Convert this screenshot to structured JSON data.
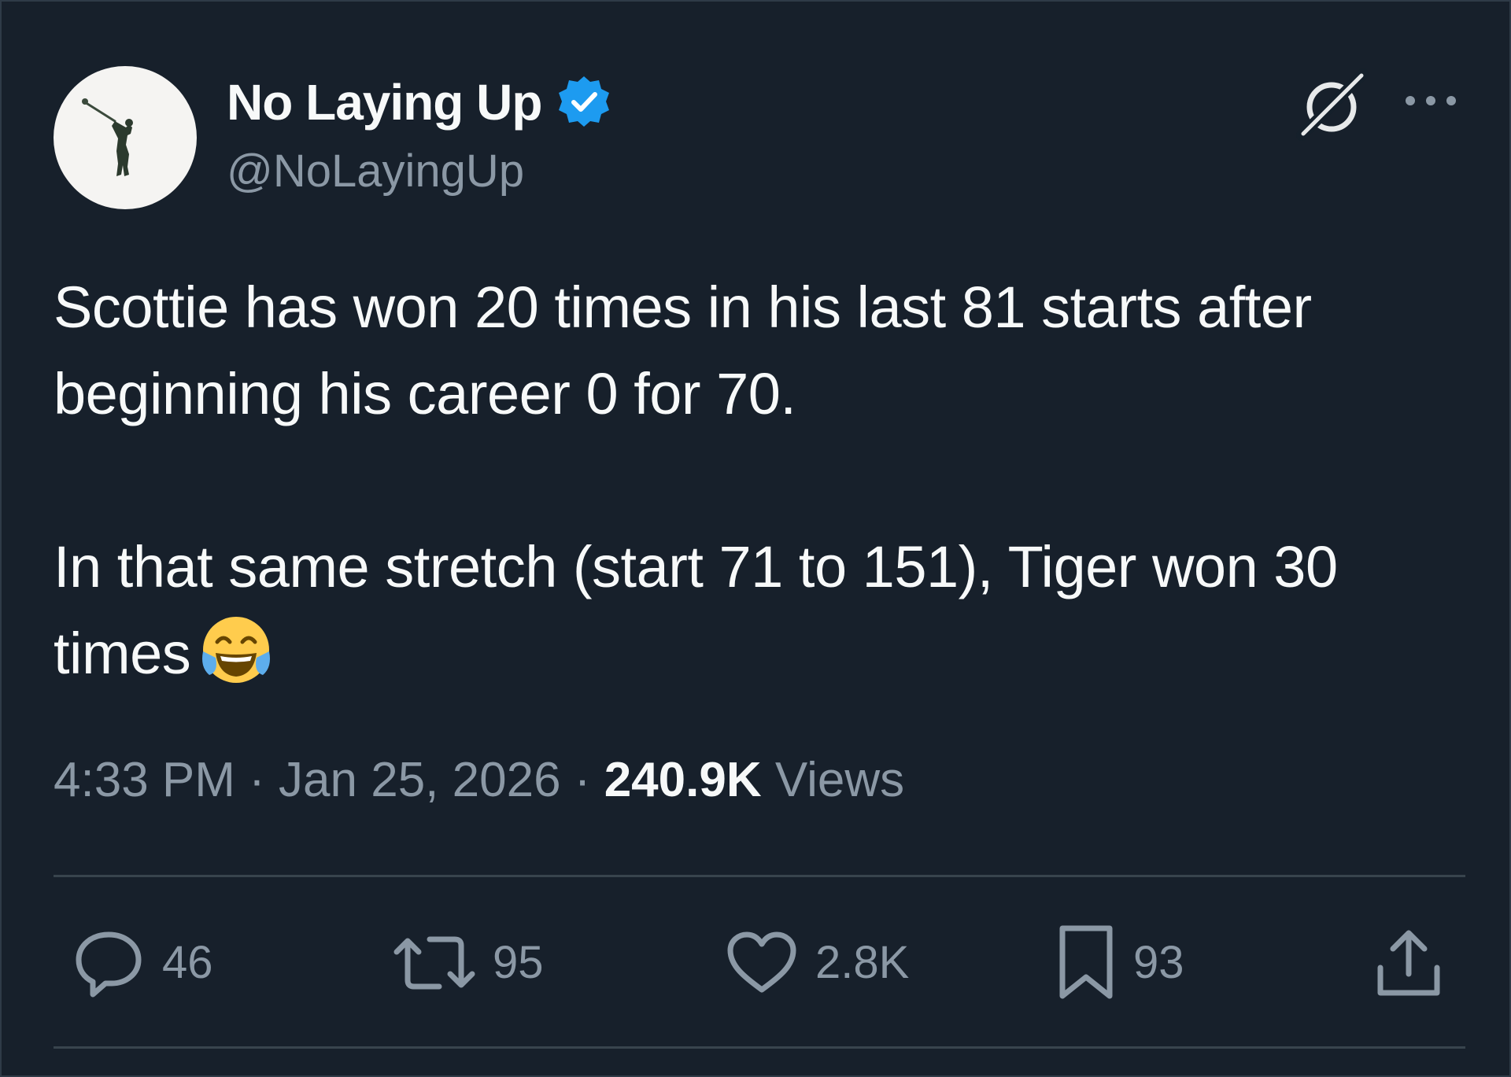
{
  "author": {
    "display_name": "No Laying Up",
    "handle": "@NoLayingUp",
    "verified": true,
    "verified_color": "#1d9bf0",
    "avatar_icon": "golfer-silhouette-icon"
  },
  "header_icons": {
    "grok": "grok-icon",
    "more": "more-icon"
  },
  "tweet": {
    "paragraphs": [
      "Scottie has won 20 times in his last 81 starts after beginning his career 0 for 70.",
      "In that same stretch (start 71 to 151), Tiger won 30 times"
    ],
    "emoji": "face-with-tears-of-joy-icon"
  },
  "meta": {
    "time": "4:33 PM",
    "separator": "·",
    "date": "Jan 25, 2026",
    "views_count": "240.9K",
    "views_label": "Views"
  },
  "actions": {
    "replies": {
      "icon": "reply-icon",
      "count": "46"
    },
    "reposts": {
      "icon": "repost-icon",
      "count": "95"
    },
    "likes": {
      "icon": "heart-icon",
      "count": "2.8K"
    },
    "bookmarks": {
      "icon": "bookmark-icon",
      "count": "93"
    },
    "share": {
      "icon": "share-icon"
    }
  },
  "colors": {
    "background": "#15202b",
    "text_primary": "#f7f9f9",
    "text_secondary": "#8b98a5",
    "divider": "#38444d"
  }
}
